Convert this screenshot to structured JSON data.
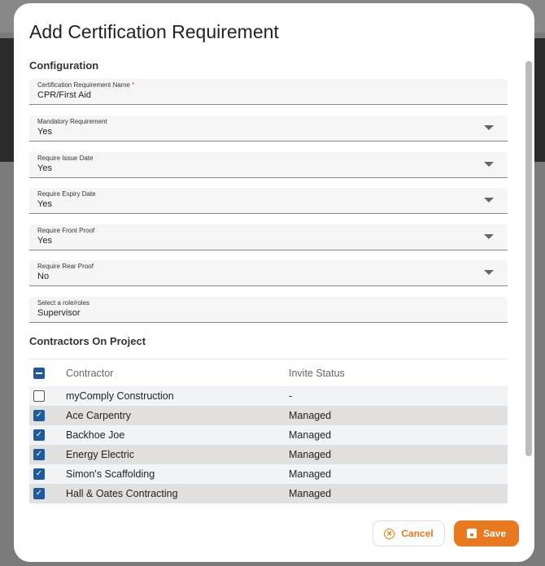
{
  "title": "Add Certification Requirement",
  "configuration_heading": "Configuration",
  "fields": [
    {
      "label": "Certification Requirement Name",
      "required_mark": "*",
      "value": "CPR/First Aid"
    },
    {
      "label": "Mandatory Requirement",
      "value": "Yes"
    },
    {
      "label": "Require Issue Date",
      "value": "Yes"
    },
    {
      "label": "Require Expiry Date",
      "value": "Yes"
    },
    {
      "label": "Require Front Proof",
      "value": "Yes"
    },
    {
      "label": "Require Rear Proof",
      "value": "No"
    },
    {
      "label": "Select a role/roles",
      "value": "Supervisor"
    }
  ],
  "contractors_heading": "Contractors On Project",
  "table": {
    "headers": [
      "Contractor",
      "Invite Status"
    ],
    "rows": [
      {
        "name": "myComply Construction",
        "status": "-",
        "checked": false
      },
      {
        "name": "Ace Carpentry",
        "status": "Managed",
        "checked": true
      },
      {
        "name": "Backhoe Joe",
        "status": "Managed",
        "checked": true
      },
      {
        "name": "Energy Electric",
        "status": "Managed",
        "checked": true
      },
      {
        "name": "Simon's Scaffolding",
        "status": "Managed",
        "checked": true
      },
      {
        "name": "Hall & Oates Contracting",
        "status": "Managed",
        "checked": true
      }
    ]
  },
  "buttons": {
    "cancel": "Cancel",
    "save": "Save"
  },
  "colors": {
    "accent": "#e8791f",
    "checkbox": "#1e5a9c"
  }
}
